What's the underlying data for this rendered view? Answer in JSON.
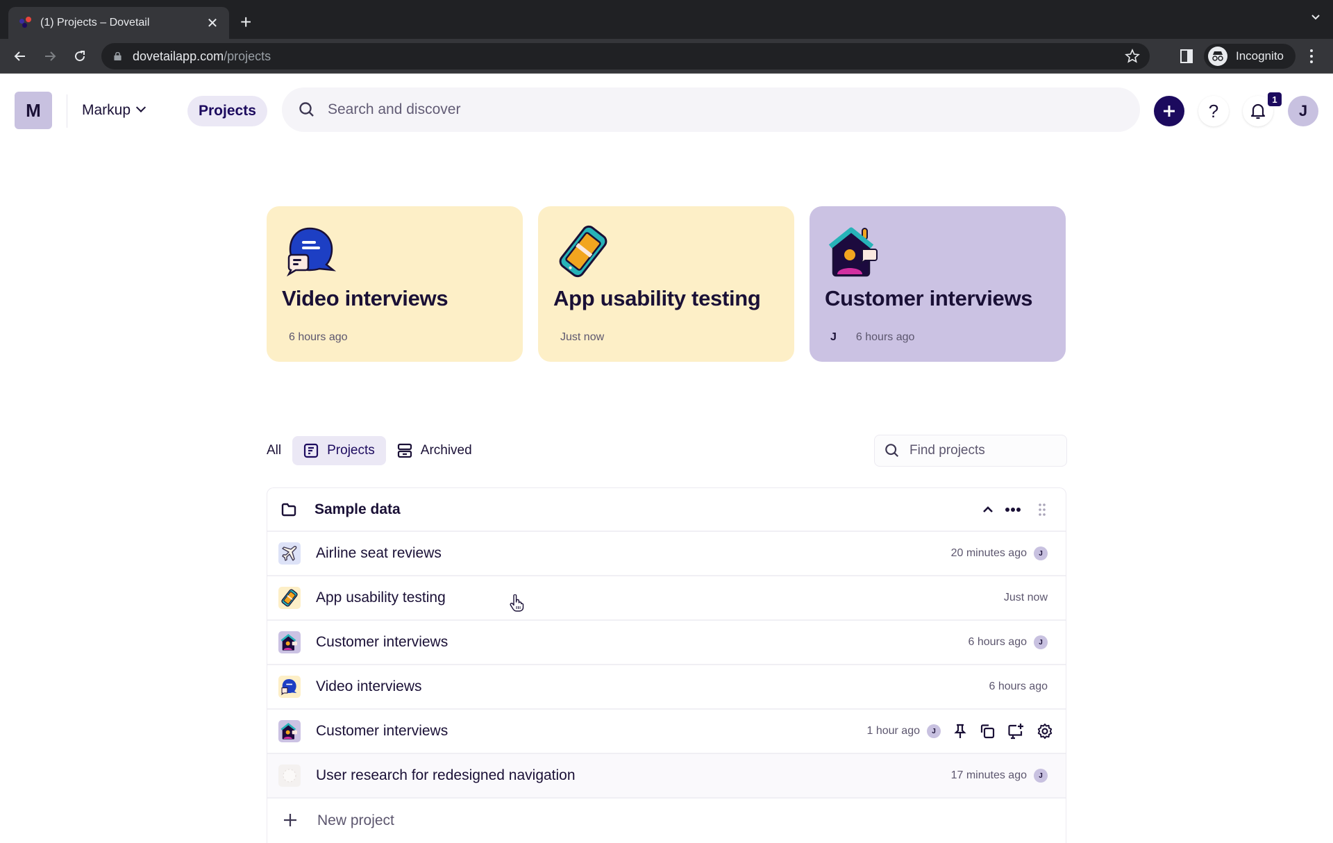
{
  "browser": {
    "tab_title": "(1) Projects – Dovetail",
    "url_domain": "dovetailapp.com",
    "url_path": "/projects",
    "profile_label": "Incognito"
  },
  "header": {
    "workspace_initial": "M",
    "workspace_name": "Markup",
    "nav_active": "Projects",
    "search_placeholder": "Search and discover",
    "notification_count": "1",
    "user_initial": "J",
    "help_label": "?",
    "colors": {
      "primary": "#1c0a5e",
      "avatar_bg": "#c8c1e0",
      "nav_active_bg": "#ebe8f5"
    }
  },
  "featured": [
    {
      "title": "Video interviews",
      "time": "6 hours ago",
      "owner": "",
      "icon": "chat-bubbles-icon",
      "bg": "#fdefc7"
    },
    {
      "title": "App usability testing",
      "time": "Just now",
      "owner": "",
      "icon": "phone-icon",
      "bg": "#fdefc7"
    },
    {
      "title": "Customer interviews",
      "time": "6 hours ago",
      "owner": "J",
      "icon": "house-person-icon",
      "bg": "#cbc2e3"
    }
  ],
  "filters": {
    "all": "All",
    "projects": "Projects",
    "archived": "Archived",
    "active": "Projects",
    "find_placeholder": "Find projects"
  },
  "group": {
    "title": "Sample data",
    "rows": [
      {
        "name": "Airline seat reviews",
        "time": "20 minutes ago",
        "owner": "J",
        "icon": "airplane-icon"
      },
      {
        "name": "App usability testing",
        "time": "Just now",
        "owner": "",
        "icon": "phone-icon"
      },
      {
        "name": "Customer interviews",
        "time": "6 hours ago",
        "owner": "J",
        "icon": "house-person-icon"
      },
      {
        "name": "Video interviews",
        "time": "6 hours ago",
        "owner": "",
        "icon": "chat-bubbles-icon"
      },
      {
        "name": "Customer interviews",
        "time": "1 hour ago",
        "owner": "J",
        "icon": "house-person-icon",
        "hovered": true
      },
      {
        "name": "User research for redesigned navigation",
        "time": "17 minutes ago",
        "owner": "J",
        "icon": "blank-project-icon"
      }
    ],
    "new_project_label": "New project"
  }
}
